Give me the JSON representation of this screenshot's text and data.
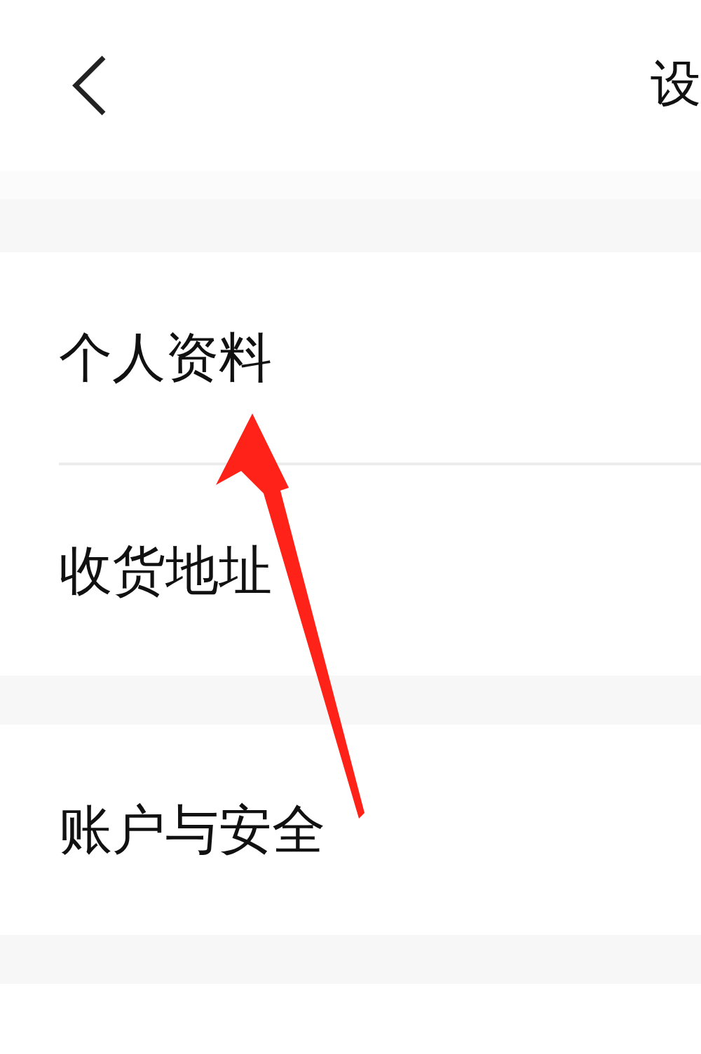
{
  "header": {
    "title": "设"
  },
  "groups": [
    {
      "items": [
        {
          "label": "个人资料"
        },
        {
          "label": "收货地址"
        }
      ]
    },
    {
      "items": [
        {
          "label": "账户与安全"
        }
      ]
    }
  ]
}
